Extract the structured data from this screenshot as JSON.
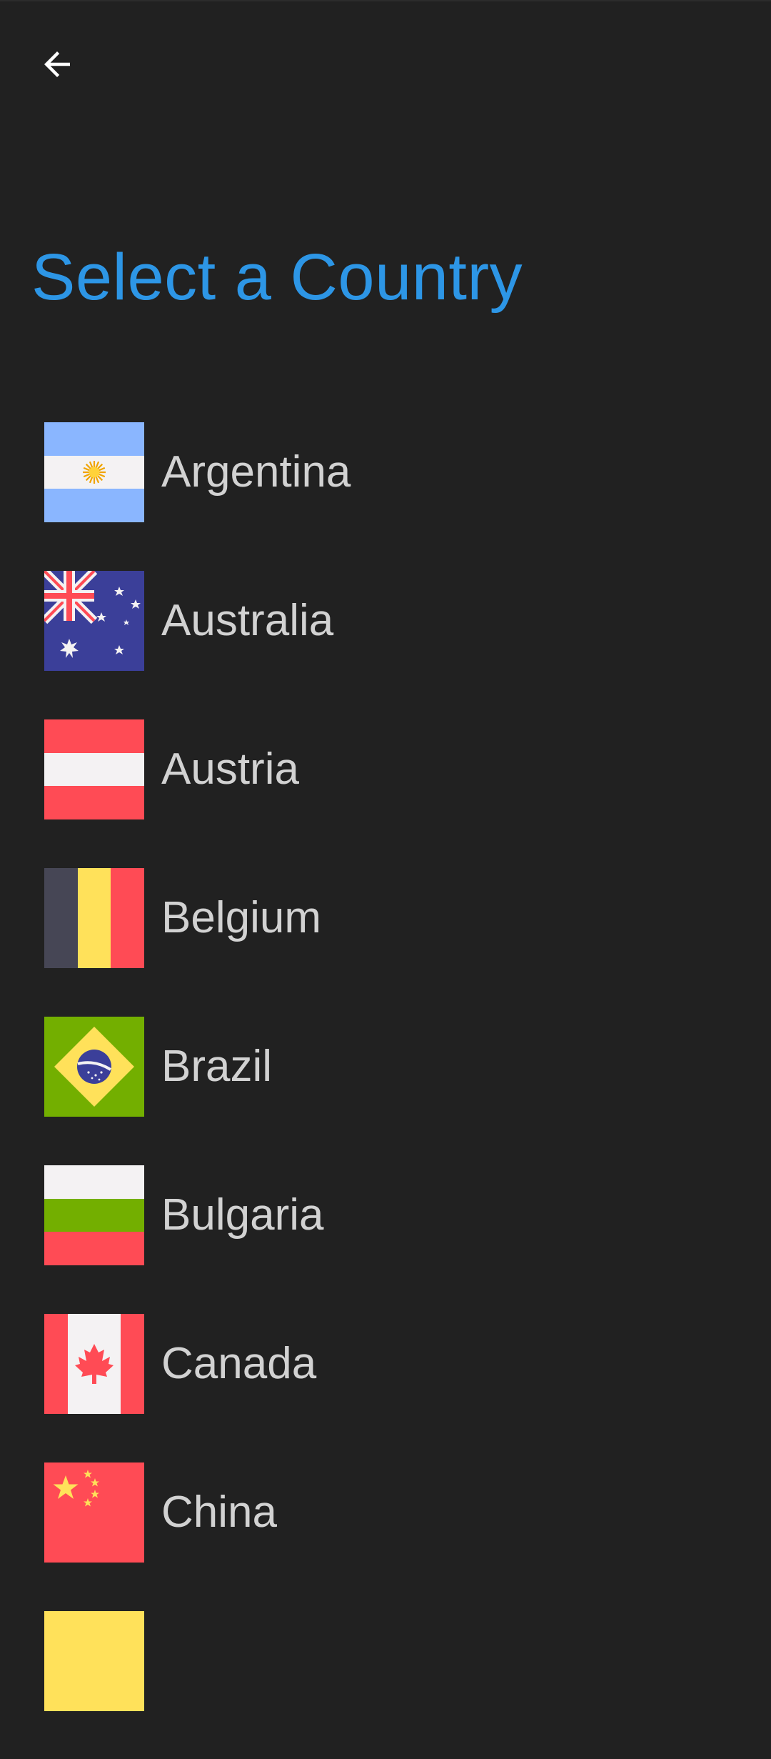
{
  "header": {
    "back_icon": "arrow-back-icon"
  },
  "title": "Select a Country",
  "colors": {
    "background": "#212121",
    "accent": "#2d96e6",
    "text": "#d2d2d2"
  },
  "countries": [
    {
      "name": "Argentina",
      "flag_icon": "argentina-flag-icon"
    },
    {
      "name": "Australia",
      "flag_icon": "australia-flag-icon"
    },
    {
      "name": "Austria",
      "flag_icon": "austria-flag-icon"
    },
    {
      "name": "Belgium",
      "flag_icon": "belgium-flag-icon"
    },
    {
      "name": "Brazil",
      "flag_icon": "brazil-flag-icon"
    },
    {
      "name": "Bulgaria",
      "flag_icon": "bulgaria-flag-icon"
    },
    {
      "name": "Canada",
      "flag_icon": "canada-flag-icon"
    },
    {
      "name": "China",
      "flag_icon": "china-flag-icon"
    },
    {
      "name": "",
      "flag_icon": "partial-flag-icon"
    }
  ]
}
